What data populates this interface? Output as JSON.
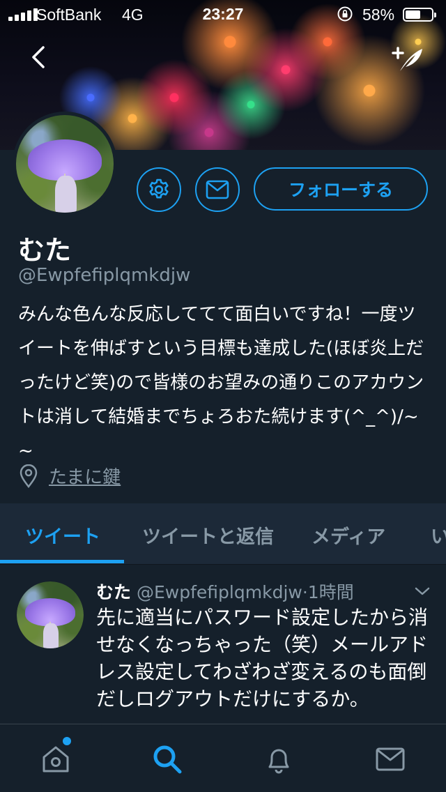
{
  "status_bar": {
    "carrier": "SoftBank",
    "network": "4G",
    "time": "23:27",
    "battery_percent": "58%",
    "battery_level": 0.58
  },
  "header": {
    "back_icon": "chevron-left-icon",
    "compose_icon": "compose-feather-icon"
  },
  "profile": {
    "display_name": "むた",
    "handle": "@Ewpfefiplqmkdjw",
    "bio": "みんな色んな反応しててて面白いですね！一度ツイートを伸ばすという目標も達成した(ほぼ炎上だったけど笑)ので皆様のお望みの通りこのアカウントは消して結婚までちょろおた続けます(^_^)/~~",
    "location": "たまに鍵",
    "follow_label": "フォローする",
    "settings_icon": "gear-icon",
    "message_icon": "envelope-icon",
    "location_icon": "location-pin-icon"
  },
  "tabs": [
    {
      "label": "ツイート",
      "active": true
    },
    {
      "label": "ツイートと返信",
      "active": false
    },
    {
      "label": "メディア",
      "active": false
    },
    {
      "label": "い",
      "active": false
    }
  ],
  "tweet": {
    "name": "むた",
    "handle": "@Ewpfefiplqmkdjw",
    "separator": "·",
    "time": "1時間",
    "text": "先に適当にパスワード設定したから消せなくなっちゃった（笑）メールアドレス設定してわざわざ変えるのも面倒だしログアウトだけにするか。"
  },
  "bottom_nav": [
    {
      "name": "home",
      "icon": "home-icon",
      "badge": true
    },
    {
      "name": "search",
      "icon": "search-icon",
      "active": true
    },
    {
      "name": "notifications",
      "icon": "bell-icon"
    },
    {
      "name": "messages",
      "icon": "envelope-icon"
    }
  ],
  "colors": {
    "background": "#15202b",
    "accent": "#1da1f2",
    "secondary_text": "#8899a6",
    "tab_bar": "#1c2938"
  }
}
